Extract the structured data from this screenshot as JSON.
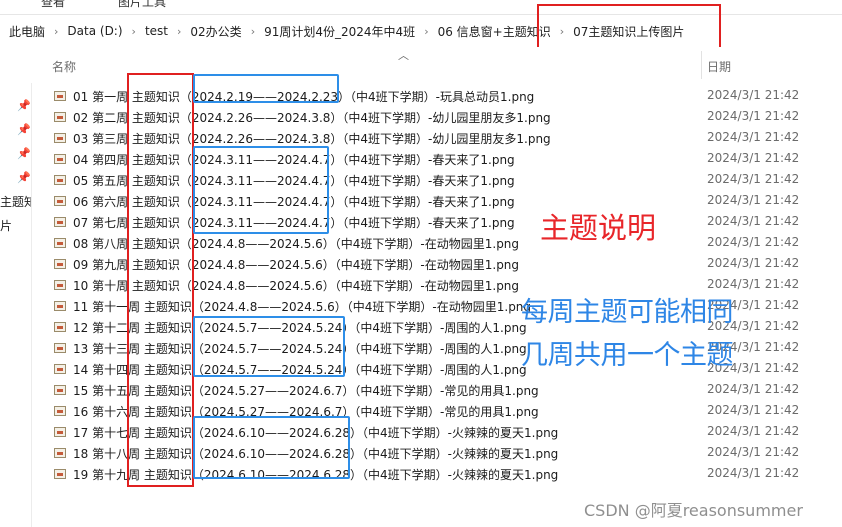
{
  "ribbon": {
    "tabs": [
      "查看",
      "图片工具"
    ]
  },
  "breadcrumb": [
    "此电脑",
    "Data (D:)",
    "test",
    "02办公类",
    "91周计划4份_2024年中4班",
    "06 信息窗+主题知识",
    "07主题知识上传图片"
  ],
  "nav_pane": {
    "items": [
      "主题知",
      "片"
    ]
  },
  "columns": {
    "name": "名称",
    "date": "日期"
  },
  "files": [
    {
      "name": "01 第一周 主题知识（2024.2.19——2024.2.23）（中4班下学期）-玩具总动员1.png",
      "date": "2024/3/1 21:42"
    },
    {
      "name": "02 第二周 主题知识（2024.2.26——2024.3.8）（中4班下学期）-幼儿园里朋友多1.png",
      "date": "2024/3/1 21:42"
    },
    {
      "name": "03 第三周 主题知识（2024.2.26——2024.3.8）（中4班下学期）-幼儿园里朋友多1.png",
      "date": "2024/3/1 21:42"
    },
    {
      "name": "04 第四周 主题知识（2024.3.11——2024.4.7）（中4班下学期）-春天来了1.png",
      "date": "2024/3/1 21:42"
    },
    {
      "name": "05 第五周 主题知识（2024.3.11——2024.4.7）（中4班下学期）-春天来了1.png",
      "date": "2024/3/1 21:42"
    },
    {
      "name": "06 第六周 主题知识（2024.3.11——2024.4.7）（中4班下学期）-春天来了1.png",
      "date": "2024/3/1 21:42"
    },
    {
      "name": "07 第七周 主题知识（2024.3.11——2024.4.7）（中4班下学期）-春天来了1.png",
      "date": "2024/3/1 21:42"
    },
    {
      "name": "08 第八周 主题知识（2024.4.8——2024.5.6）（中4班下学期）-在动物园里1.png",
      "date": "2024/3/1 21:42"
    },
    {
      "name": "09 第九周 主题知识（2024.4.8——2024.5.6）（中4班下学期）-在动物园里1.png",
      "date": "2024/3/1 21:42"
    },
    {
      "name": "10 第十周 主题知识（2024.4.8——2024.5.6）（中4班下学期）-在动物园里1.png",
      "date": "2024/3/1 21:42"
    },
    {
      "name": "11 第十一周 主题知识（2024.4.8——2024.5.6）（中4班下学期）-在动物园里1.png",
      "date": "2024/3/1 21:42"
    },
    {
      "name": "12 第十二周 主题知识（2024.5.7——2024.5.24）（中4班下学期）-周围的人1.png",
      "date": "2024/3/1 21:42"
    },
    {
      "name": "13 第十三周 主题知识（2024.5.7——2024.5.24）（中4班下学期）-周围的人1.png",
      "date": "2024/3/1 21:42"
    },
    {
      "name": "14 第十四周 主题知识（2024.5.7——2024.5.24）（中4班下学期）-周围的人1.png",
      "date": "2024/3/1 21:42"
    },
    {
      "name": "15 第十五周 主题知识（2024.5.27——2024.6.7）（中4班下学期）-常见的用具1.png",
      "date": "2024/3/1 21:42"
    },
    {
      "name": "16 第十六周 主题知识（2024.5.27——2024.6.7）（中4班下学期）-常见的用具1.png",
      "date": "2024/3/1 21:42"
    },
    {
      "name": "17 第十七周 主题知识（2024.6.10——2024.6.28）（中4班下学期）-火辣辣的夏天1.png",
      "date": "2024/3/1 21:42"
    },
    {
      "name": "18 第十八周 主题知识（2024.6.10——2024.6.28）（中4班下学期）-火辣辣的夏天1.png",
      "date": "2024/3/1 21:42"
    },
    {
      "name": "19 第十九周 主题知识（2024.6.10——2024.6.28）（中4班下学期）-火辣辣的夏天1.png",
      "date": "2024/3/1 21:42"
    }
  ],
  "annotations": {
    "red_label": "主题说明",
    "blue_line1": "每周主题可能相同",
    "blue_line2": "几周共用一个主题"
  },
  "watermark": "CSDN @阿夏reasonsummer",
  "colors": {
    "red_annotation": "#e02020",
    "blue_annotation": "#2d8ee8"
  }
}
